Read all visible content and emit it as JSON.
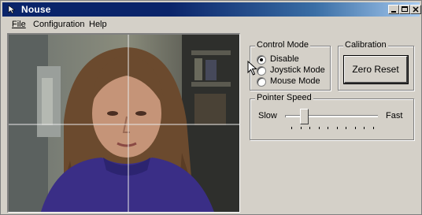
{
  "window": {
    "title": "Nouse"
  },
  "menu": {
    "file": "File",
    "configuration": "Configuration",
    "help": "Help"
  },
  "control_mode": {
    "title": "Control Mode",
    "options": [
      {
        "label": "Disable",
        "selected": true
      },
      {
        "label": "Joystick Mode",
        "selected": false
      },
      {
        "label": "Mouse Mode",
        "selected": false
      }
    ]
  },
  "calibration": {
    "title": "Calibration",
    "button_label": "Zero Reset"
  },
  "pointer_speed": {
    "title": "Pointer Speed",
    "min_label": "Slow",
    "max_label": "Fast",
    "value_fraction": 0.2,
    "tick_count": 10
  }
}
